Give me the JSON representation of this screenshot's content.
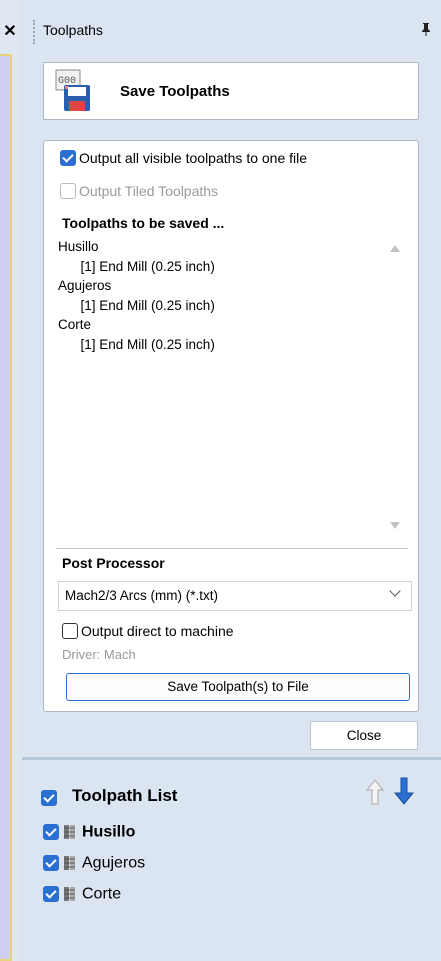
{
  "left_panel": {
    "close_icon": "✕"
  },
  "header": {
    "title": "Toolpaths",
    "pin_icon": "pin-icon",
    "pin_glyph": "ᵖ"
  },
  "save_header": {
    "label": "Save Toolpaths",
    "icon": "save-gcode-icon",
    "icon_text": "G00"
  },
  "options": {
    "output_all": {
      "label": "Output all visible toolpaths to one file",
      "checked": true
    },
    "output_tiled": {
      "label": "Output Tiled Toolpaths",
      "checked": false,
      "disabled": true
    }
  },
  "toolpaths_to_save": {
    "title": "Toolpaths to be saved ...",
    "lines": [
      "Husillo",
      "      [1] End Mill (0.25 inch)",
      "Agujeros",
      "      [1] End Mill (0.25 inch)",
      "Corte",
      "      [1] End Mill (0.25 inch)"
    ]
  },
  "post_processor": {
    "title": "Post Processor",
    "selected": "Mach2/3 Arcs (mm) (*.txt)",
    "output_direct": {
      "label": "Output direct to machine",
      "checked": false
    },
    "driver": "Driver: Mach",
    "save_button": "Save Toolpath(s) to File"
  },
  "close_button": "Close",
  "toolpath_list": {
    "title": "Toolpath List",
    "items": [
      {
        "label": "Husillo",
        "bold": true,
        "checked": true
      },
      {
        "label": "Agujeros",
        "bold": false,
        "checked": true
      },
      {
        "label": "Corte",
        "bold": false,
        "checked": true
      }
    ]
  },
  "colors": {
    "accent": "#2a6fd1",
    "panel_bg": "#dbe5f1",
    "left_panel": "#cfcff2"
  }
}
